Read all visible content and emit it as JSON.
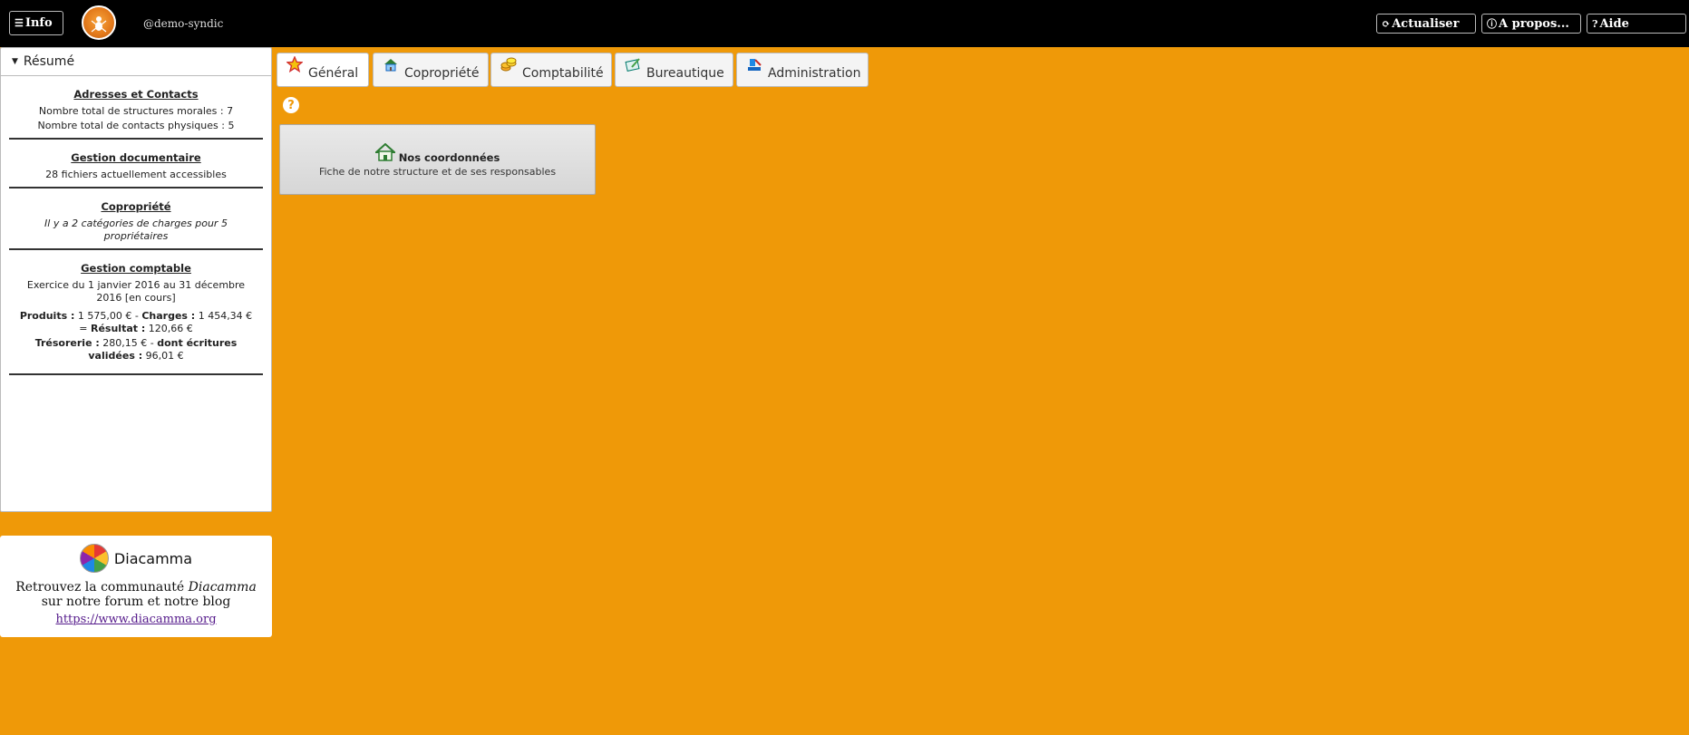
{
  "topbar": {
    "info_label": "Info",
    "username": "@demo-syndic",
    "refresh_label": "Actualiser",
    "about_label": "A propos...",
    "help_label": "Aide"
  },
  "sidebar": {
    "header": "Résumé",
    "sections": {
      "contacts": {
        "title": "Adresses et Contacts",
        "line1": "Nombre total de structures morales : 7",
        "line2": "Nombre total de contacts physiques : 5"
      },
      "documents": {
        "title": "Gestion documentaire",
        "line1": "28 fichiers actuellement accessibles"
      },
      "copro": {
        "title": "Copropriété",
        "line1": "Il y a 2 catégories de charges pour 5 propriétaires"
      },
      "accounting": {
        "title": "Gestion comptable",
        "exercise": "Exercice du 1 janvier 2016 au 31 décembre 2016 [en cours]",
        "produits_label": "Produits :",
        "produits_value": " 1 575,00 € - ",
        "charges_label": "Charges :",
        "charges_value": " 1 454,34 € = ",
        "resultat_label": "Résultat :",
        "resultat_value": " 120,66 €",
        "tresorerie_label": "Trésorerie :",
        "tresorerie_value": " 280,15 € - ",
        "validees_label": "dont écritures validées :",
        "validees_value": " 96,01 €"
      }
    }
  },
  "community": {
    "brand": "Diacamma",
    "text_before": "Retrouvez la communauté ",
    "text_em": "Diacamma",
    "text_after": " sur notre forum et notre blog",
    "link": "https://www.diacamma.org"
  },
  "tabs": [
    {
      "label": "Général",
      "icon": "star-icon"
    },
    {
      "label": "Copropriété",
      "icon": "building-icon"
    },
    {
      "label": "Comptabilité",
      "icon": "coins-icon"
    },
    {
      "label": "Bureautique",
      "icon": "document-icon"
    },
    {
      "label": "Administration",
      "icon": "admin-icon"
    }
  ],
  "main": {
    "card": {
      "title": "Nos coordonnées",
      "description": "Fiche de notre structure et de ses responsables",
      "icon": "house-icon"
    }
  },
  "colors": {
    "background": "#ef9908",
    "topbar": "#000000"
  }
}
